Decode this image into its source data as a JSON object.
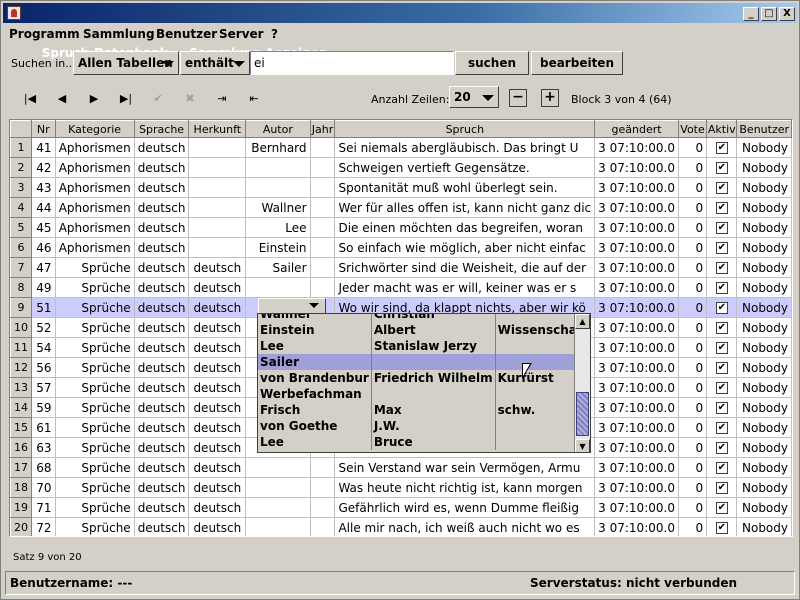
{
  "window": {
    "title": "Spruch-Datenbank  -  Sammlung Anzeigen",
    "minimize_label": "_",
    "maximize_label": "□",
    "close_label": "X"
  },
  "menu": [
    "Programm",
    "Sammlung",
    "Benutzer",
    "Server",
    "?"
  ],
  "search": {
    "label": "Suchen in...",
    "table_select": "Allen Tabellen",
    "operator_select": "enthält",
    "query": "ei",
    "search_button": "suchen",
    "edit_button": "bearbeiten"
  },
  "navigation": {
    "icons": [
      "first-record-icon",
      "prev-record-icon",
      "next-record-icon",
      "last-record-icon",
      "confirm-icon",
      "cancel-icon",
      "export-icon",
      "import-icon"
    ],
    "glyphs": {
      "first": "|◀",
      "prev": "◀",
      "next": "▶",
      "last": "▶|",
      "confirm": "✔",
      "cancel": "✖",
      "export": "⇥",
      "import": "⇤"
    },
    "rows_label": "Anzahl Zeilen:",
    "rows_value": "20",
    "minus_label": "−",
    "plus_label": "+",
    "block_info": "Block 3 von 4 (64)"
  },
  "table": {
    "columns": [
      "",
      "Nr",
      "Kategorie",
      "Sprache",
      "Herkunft",
      "Autor",
      "Jahr",
      "Spruch",
      "geändert",
      "Vote",
      "Aktiv",
      "Benutzer"
    ],
    "rows": [
      {
        "row": "1",
        "nr": "41",
        "kategorie": "Aphorismen",
        "sprache": "deutsch",
        "herkunft": "",
        "autor": "Bernhard",
        "jahr": "",
        "spruch": "Sei niemals abergläubisch. Das bringt U",
        "geaendert": "3 07:10:00.0",
        "vote": "0",
        "aktiv": "✔",
        "benutzer": "Nobody"
      },
      {
        "row": "2",
        "nr": "42",
        "kategorie": "Aphorismen",
        "sprache": "deutsch",
        "herkunft": "",
        "autor": "",
        "jahr": "",
        "spruch": "Schweigen vertieft Gegensätze.",
        "geaendert": "3 07:10:00.0",
        "vote": "0",
        "aktiv": "✔",
        "benutzer": "Nobody"
      },
      {
        "row": "3",
        "nr": "43",
        "kategorie": "Aphorismen",
        "sprache": "deutsch",
        "herkunft": "",
        "autor": "",
        "jahr": "",
        "spruch": "Spontanität muß wohl überlegt sein.",
        "geaendert": "3 07:10:00.0",
        "vote": "0",
        "aktiv": "✔",
        "benutzer": "Nobody"
      },
      {
        "row": "4",
        "nr": "44",
        "kategorie": "Aphorismen",
        "sprache": "deutsch",
        "herkunft": "",
        "autor": "Wallner",
        "jahr": "",
        "spruch": "Wer für alles offen ist, kann nicht ganz dic",
        "geaendert": "3 07:10:00.0",
        "vote": "0",
        "aktiv": "✔",
        "benutzer": "Nobody"
      },
      {
        "row": "5",
        "nr": "45",
        "kategorie": "Aphorismen",
        "sprache": "deutsch",
        "herkunft": "",
        "autor": "Lee",
        "jahr": "",
        "spruch": "Die einen möchten das begreifen, woran",
        "geaendert": "3 07:10:00.0",
        "vote": "0",
        "aktiv": "✔",
        "benutzer": "Nobody"
      },
      {
        "row": "6",
        "nr": "46",
        "kategorie": "Aphorismen",
        "sprache": "deutsch",
        "herkunft": "",
        "autor": "Einstein",
        "jahr": "",
        "spruch": "So einfach wie möglich, aber nicht einfac",
        "geaendert": "3 07:10:00.0",
        "vote": "0",
        "aktiv": "✔",
        "benutzer": "Nobody"
      },
      {
        "row": "7",
        "nr": "47",
        "kategorie": "Sprüche",
        "sprache": "deutsch",
        "herkunft": "deutsch",
        "autor": "Sailer",
        "jahr": "",
        "spruch": "Srichwörter sind die Weisheit, die auf der",
        "geaendert": "3 07:10:00.0",
        "vote": "0",
        "aktiv": "✔",
        "benutzer": "Nobody"
      },
      {
        "row": "8",
        "nr": "49",
        "kategorie": "Sprüche",
        "sprache": "deutsch",
        "herkunft": "deutsch",
        "autor": "",
        "jahr": "",
        "spruch": "Jeder macht was er will, keiner was er s",
        "geaendert": "3 07:10:00.0",
        "vote": "0",
        "aktiv": "✔",
        "benutzer": "Nobody"
      },
      {
        "row": "9",
        "nr": "51",
        "kategorie": "Sprüche",
        "sprache": "deutsch",
        "herkunft": "deutsch",
        "autor": "",
        "jahr": "",
        "spruch": "Wo wir sind, da klappt nichts, aber wir kö",
        "geaendert": "3 07:10:00.0",
        "vote": "0",
        "aktiv": "✔",
        "benutzer": "Nobody"
      },
      {
        "row": "10",
        "nr": "52",
        "kategorie": "Sprüche",
        "sprache": "deutsch",
        "herkunft": "deutsch",
        "autor": "",
        "jahr": "",
        "spruch": "",
        "geaendert": "3 07:10:00.0",
        "vote": "0",
        "aktiv": "✔",
        "benutzer": "Nobody"
      },
      {
        "row": "11",
        "nr": "54",
        "kategorie": "Sprüche",
        "sprache": "deutsch",
        "herkunft": "deutsch",
        "autor": "",
        "jahr": "",
        "spruch": "",
        "geaendert": "3 07:10:00.0",
        "vote": "0",
        "aktiv": "✔",
        "benutzer": "Nobody"
      },
      {
        "row": "12",
        "nr": "56",
        "kategorie": "Sprüche",
        "sprache": "deutsch",
        "herkunft": "deutsch",
        "autor": "",
        "jahr": "",
        "spruch": "",
        "geaendert": "3 07:10:00.0",
        "vote": "0",
        "aktiv": "✔",
        "benutzer": "Nobody"
      },
      {
        "row": "13",
        "nr": "57",
        "kategorie": "Sprüche",
        "sprache": "deutsch",
        "herkunft": "deutsch",
        "autor": "",
        "jahr": "",
        "spruch": "",
        "geaendert": "3 07:10:00.0",
        "vote": "0",
        "aktiv": "✔",
        "benutzer": "Nobody"
      },
      {
        "row": "14",
        "nr": "59",
        "kategorie": "Sprüche",
        "sprache": "deutsch",
        "herkunft": "deutsch",
        "autor": "",
        "jahr": "",
        "spruch": "",
        "geaendert": "3 07:10:00.0",
        "vote": "0",
        "aktiv": "✔",
        "benutzer": "Nobody"
      },
      {
        "row": "15",
        "nr": "61",
        "kategorie": "Sprüche",
        "sprache": "deutsch",
        "herkunft": "deutsch",
        "autor": "",
        "jahr": "",
        "spruch": "",
        "geaendert": "3 07:10:00.0",
        "vote": "0",
        "aktiv": "✔",
        "benutzer": "Nobody"
      },
      {
        "row": "16",
        "nr": "63",
        "kategorie": "Sprüche",
        "sprache": "deutsch",
        "herkunft": "deutsch",
        "autor": "",
        "jahr": "",
        "spruch": "",
        "geaendert": "3 07:10:00.0",
        "vote": "0",
        "aktiv": "✔",
        "benutzer": "Nobody"
      },
      {
        "row": "17",
        "nr": "68",
        "kategorie": "Sprüche",
        "sprache": "deutsch",
        "herkunft": "deutsch",
        "autor": "",
        "jahr": "",
        "spruch": "Sein Verstand war sein Vermögen, Armu",
        "geaendert": "3 07:10:00.0",
        "vote": "0",
        "aktiv": "✔",
        "benutzer": "Nobody"
      },
      {
        "row": "18",
        "nr": "70",
        "kategorie": "Sprüche",
        "sprache": "deutsch",
        "herkunft": "deutsch",
        "autor": "",
        "jahr": "",
        "spruch": "Was heute nicht richtig ist, kann morgen",
        "geaendert": "3 07:10:00.0",
        "vote": "0",
        "aktiv": "✔",
        "benutzer": "Nobody"
      },
      {
        "row": "19",
        "nr": "71",
        "kategorie": "Sprüche",
        "sprache": "deutsch",
        "herkunft": "deutsch",
        "autor": "",
        "jahr": "",
        "spruch": "Gefährlich wird es, wenn Dumme fleißig",
        "geaendert": "3 07:10:00.0",
        "vote": "0",
        "aktiv": "✔",
        "benutzer": "Nobody"
      },
      {
        "row": "20",
        "nr": "72",
        "kategorie": "Sprüche",
        "sprache": "deutsch",
        "herkunft": "deutsch",
        "autor": "",
        "jahr": "",
        "spruch": "Alle mir nach, ich weiß auch nicht wo es",
        "geaendert": "3 07:10:00.0",
        "vote": "0",
        "aktiv": "✔",
        "benutzer": "Nobody"
      }
    ],
    "selected_row": "9"
  },
  "author_dropdown": {
    "items": [
      {
        "last": "Wallner",
        "first": "Christian",
        "note": ""
      },
      {
        "last": "Einstein",
        "first": "Albert",
        "note": "Wissenschaftler"
      },
      {
        "last": "Lee",
        "first": "Stanislaw Jerzy",
        "note": ""
      },
      {
        "last": "Sailer",
        "first": "",
        "note": ""
      },
      {
        "last": "von Brandenbur",
        "first": "Friedrich Wilhelm",
        "note": "Kurfürst"
      },
      {
        "last": "Werbefachman",
        "first": "",
        "note": ""
      },
      {
        "last": "Frisch",
        "first": "Max",
        "note": "schw."
      },
      {
        "last": "von Goethe",
        "first": "J.W.",
        "note": ""
      },
      {
        "last": "Lee",
        "first": "Bruce",
        "note": ""
      }
    ],
    "highlighted": "Sailer"
  },
  "footer": {
    "record_info": "Satz 9 von 20",
    "username": "Benutzername: ---",
    "server_status": "Serverstatus: nicht verbunden"
  },
  "colors": {
    "selection": "#ccccff",
    "dropdown_highlight": "#a0a0d8",
    "titlebar": "#0a246a",
    "background": "#d4d0c8"
  }
}
